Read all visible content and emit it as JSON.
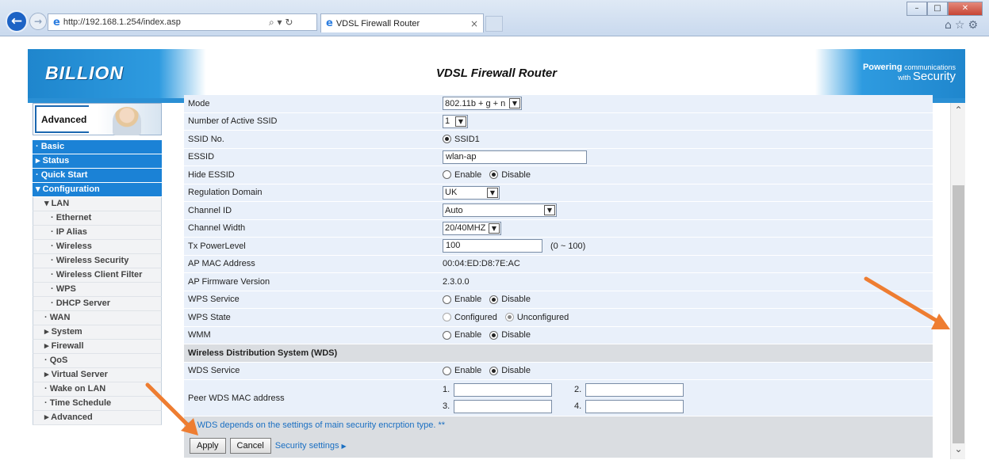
{
  "browser": {
    "url": "http://192.168.1.254/index.asp",
    "addr_tools": "⌕ ▾ ↻",
    "tab_title": "VDSL Firewall Router",
    "tab_close": "×",
    "win_min": "–",
    "win_max": "□",
    "win_close": "✕",
    "toolbar_icons": "⌂☆⚙"
  },
  "header": {
    "logo": "BILLION",
    "title": "VDSL Firewall Router",
    "tagline_line1": "Powering",
    "tagline_line1b": "communications",
    "tagline_line2": "with",
    "tagline_line2b": "Security"
  },
  "sidebar": {
    "banner_label": "Advanced",
    "items": [
      {
        "label": "· Basic",
        "level": 0
      },
      {
        "label": "▸ Status",
        "level": 0
      },
      {
        "label": "· Quick Start",
        "level": 0
      },
      {
        "label": "▾ Configuration",
        "level": 0
      },
      {
        "label": "▾ LAN",
        "level": 1
      },
      {
        "label": "· Ethernet",
        "level": 2
      },
      {
        "label": "· IP Alias",
        "level": 2
      },
      {
        "label": "· Wireless",
        "level": 2
      },
      {
        "label": "· Wireless Security",
        "level": 2
      },
      {
        "label": "· Wireless Client Filter",
        "level": 2
      },
      {
        "label": "· WPS",
        "level": 2
      },
      {
        "label": "· DHCP Server",
        "level": 2
      },
      {
        "label": "· WAN",
        "level": 1
      },
      {
        "label": "▸ System",
        "level": 1
      },
      {
        "label": "▸ Firewall",
        "level": 1
      },
      {
        "label": "· QoS",
        "level": 1
      },
      {
        "label": "▸ Virtual Server",
        "level": 1
      },
      {
        "label": "· Wake on LAN",
        "level": 1
      },
      {
        "label": "· Time Schedule",
        "level": 1
      },
      {
        "label": "▸ Advanced",
        "level": 1
      }
    ]
  },
  "form": {
    "mode": {
      "label": "Mode",
      "value": "802.11b + g + n"
    },
    "active_ssid": {
      "label": "Number of Active SSID",
      "value": "1"
    },
    "ssid_no": {
      "label": "SSID No.",
      "value": "SSID1"
    },
    "essid": {
      "label": "ESSID",
      "value": "wlan-ap"
    },
    "hide_essid": {
      "label": "Hide ESSID",
      "enable": "Enable",
      "disable": "Disable",
      "selected": "Disable"
    },
    "regulation": {
      "label": "Regulation Domain",
      "value": "UK"
    },
    "channel_id": {
      "label": "Channel ID",
      "value": "Auto"
    },
    "channel_width": {
      "label": "Channel Width",
      "value": "20/40MHZ"
    },
    "tx_power": {
      "label": "Tx PowerLevel",
      "value": "100",
      "range": "(0 ~ 100)"
    },
    "mac": {
      "label": "AP MAC Address",
      "value": "00:04:ED:D8:7E:AC"
    },
    "firmware": {
      "label": "AP Firmware Version",
      "value": "2.3.0.0"
    },
    "wps_service": {
      "label": "WPS Service",
      "enable": "Enable",
      "disable": "Disable",
      "selected": "Disable"
    },
    "wps_state": {
      "label": "WPS State",
      "configured": "Configured",
      "unconfigured": "Unconfigured",
      "selected": "Unconfigured"
    },
    "wmm": {
      "label": "WMM",
      "enable": "Enable",
      "disable": "Disable",
      "selected": "Disable"
    },
    "wds_section": "Wireless Distribution System (WDS)",
    "wds_service": {
      "label": "WDS Service",
      "enable": "Enable",
      "disable": "Disable",
      "selected": "Disable"
    },
    "peer_wds": {
      "label": "Peer WDS MAC address",
      "n1": "1.",
      "n2": "2.",
      "n3": "3.",
      "n4": "4.",
      "v1": "",
      "v2": "",
      "v3": "",
      "v4": ""
    },
    "note": "** WDS depends on the settings of main security encrption type. **",
    "apply": "Apply",
    "cancel": "Cancel",
    "security_link": "Security settings",
    "link_arrow": "▶"
  },
  "scrollbar": {
    "up": "⌃",
    "down": "⌄"
  },
  "colors": {
    "accent": "#1b82d6",
    "annotation_arrow": "#ee7d31"
  }
}
